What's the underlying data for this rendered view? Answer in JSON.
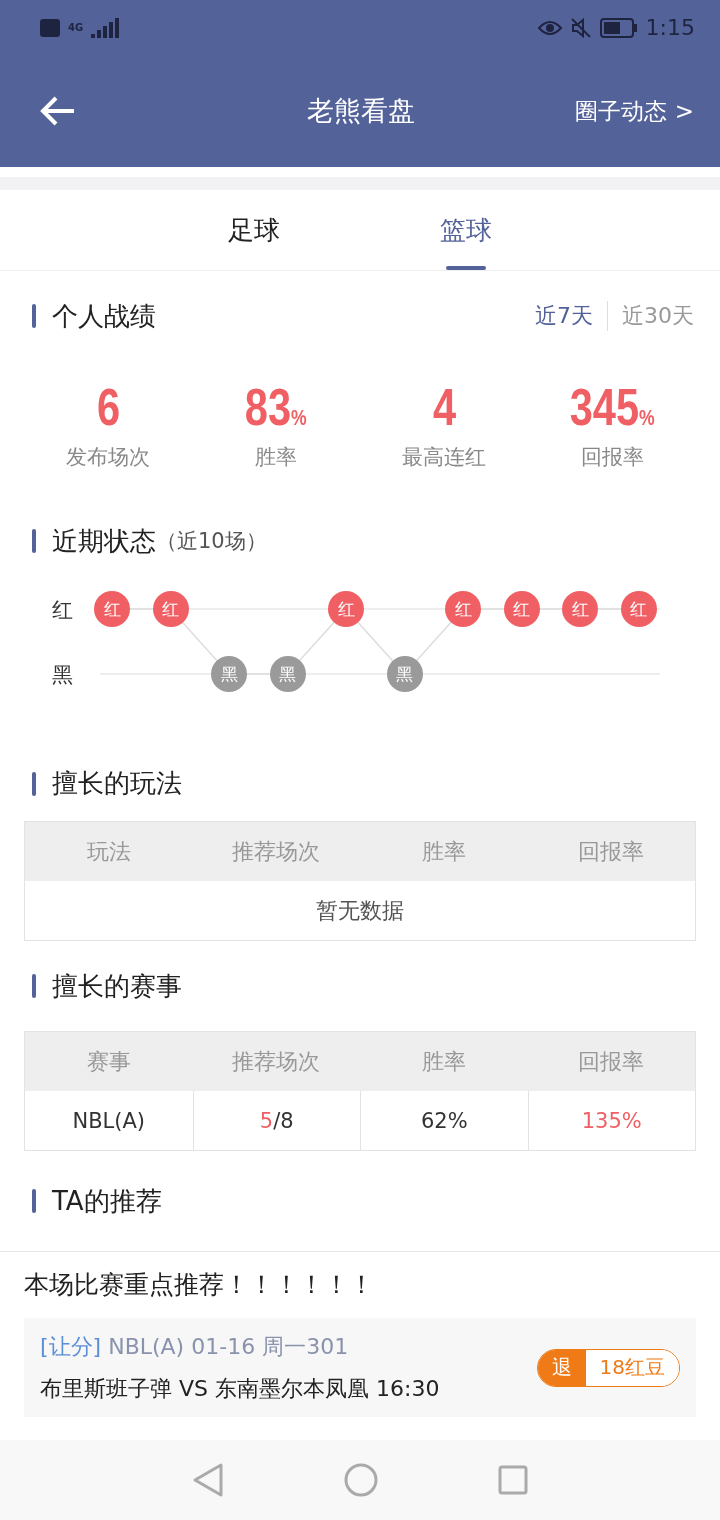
{
  "status_bar": {
    "time": "1:15",
    "network": "4G"
  },
  "header": {
    "title": "老熊看盘",
    "link": "圈子动态 >"
  },
  "tabs": [
    {
      "label": "足球",
      "selected": false
    },
    {
      "label": "篮球",
      "selected": true
    }
  ],
  "record": {
    "title": "个人战绩",
    "periods": [
      {
        "label": "近7天",
        "selected": true
      },
      {
        "label": "近30天",
        "selected": false
      }
    ],
    "stats": [
      {
        "value": "6",
        "label": "发布场次"
      },
      {
        "value": "83",
        "unit": "%",
        "label": "胜率"
      },
      {
        "value": "4",
        "label": "最高连红"
      },
      {
        "value": "345",
        "unit": "%",
        "label": "回报率"
      }
    ]
  },
  "recent": {
    "title": "近期状态",
    "subtitle": "（近10场）",
    "row_labels": [
      "红",
      "黑"
    ],
    "results": [
      {
        "label": "红",
        "kind": "win"
      },
      {
        "label": "红",
        "kind": "win"
      },
      {
        "label": "黑",
        "kind": "loss"
      },
      {
        "label": "黑",
        "kind": "loss"
      },
      {
        "label": "红",
        "kind": "win"
      },
      {
        "label": "黑",
        "kind": "loss"
      },
      {
        "label": "红",
        "kind": "win"
      },
      {
        "label": "红",
        "kind": "win"
      },
      {
        "label": "红",
        "kind": "win"
      },
      {
        "label": "红",
        "kind": "win"
      }
    ]
  },
  "plays": {
    "title": "擅长的玩法",
    "columns": [
      "玩法",
      "推荐场次",
      "胜率",
      "回报率"
    ],
    "empty": "暂无数据"
  },
  "leagues": {
    "title": "擅长的赛事",
    "columns": [
      "赛事",
      "推荐场次",
      "胜率",
      "回报率"
    ],
    "rows": [
      {
        "league": "NBL(A)",
        "wins": "5",
        "total": "/8",
        "rate": "62%",
        "return": "135%"
      }
    ]
  },
  "picks": {
    "title": "TA的推荐",
    "headline": "本场比赛重点推荐！！！！！！",
    "items": [
      {
        "tag": "[让分]",
        "league": "NBL(A)",
        "date": "01-16",
        "code": "周一301",
        "match": "布里斯班子弹 VS 东南墨尔本凤凰",
        "time": "16:30",
        "badge": "退",
        "price": "18红豆"
      }
    ]
  }
}
